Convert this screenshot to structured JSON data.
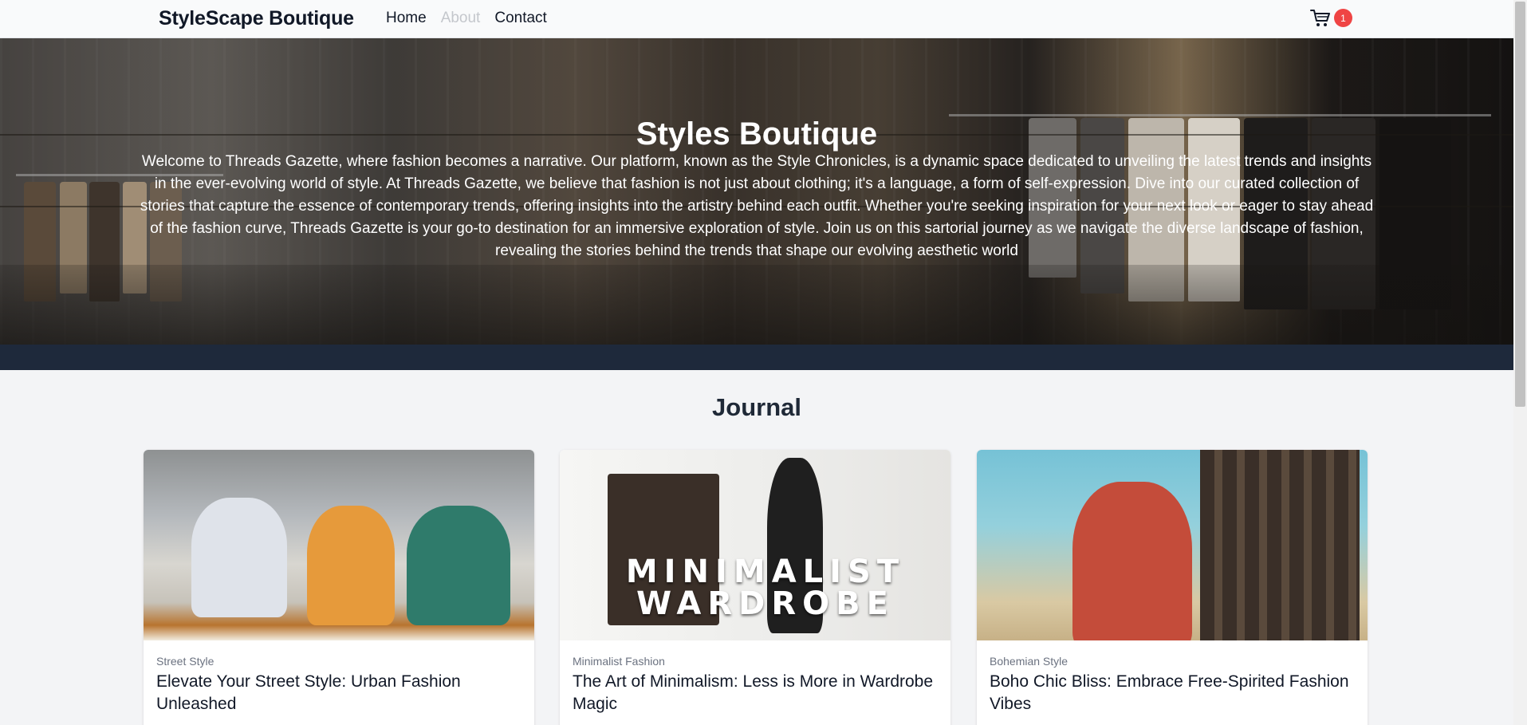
{
  "nav": {
    "brand": "StyleScape Boutique",
    "links": [
      "Home",
      "About",
      "Contact"
    ],
    "cart_icon": "shopping-cart-icon",
    "cart_count": "1",
    "accent_color": "#ef4444"
  },
  "hero": {
    "title": "Styles Boutique",
    "text": "Welcome to Threads Gazette, where fashion becomes a narrative. Our platform, known as the Style Chronicles, is a dynamic space dedicated to unveiling the latest trends and insights in the ever-evolving world of style. At Threads Gazette, we believe that fashion is not just about clothing; it's a language, a form of self-expression. Dive into our curated collection of stories that capture the essence of contemporary trends, offering insights into the artistry behind each outfit. Whether you're seeking inspiration for your next look or eager to stay ahead of the fashion curve, Threads Gazette is your go-to destination for an immersive exploration of style. Join us on this sartorial journey as we navigate the diverse landscape of fashion, revealing the stories behind the trends that shape our evolving aesthetic world"
  },
  "journal": {
    "title": "Journal",
    "cards": [
      {
        "category": "Street Style",
        "title": "Elevate Your Street Style: Urban Fashion Unleashed"
      },
      {
        "category": "Minimalist Fashion",
        "title": "The Art of Minimalism: Less is More in Wardrobe Magic",
        "image_text": "MINIMALIST WARDROBE"
      },
      {
        "category": "Bohemian Style",
        "title": "Boho Chic Bliss: Embrace Free-Spirited Fashion Vibes"
      }
    ]
  }
}
